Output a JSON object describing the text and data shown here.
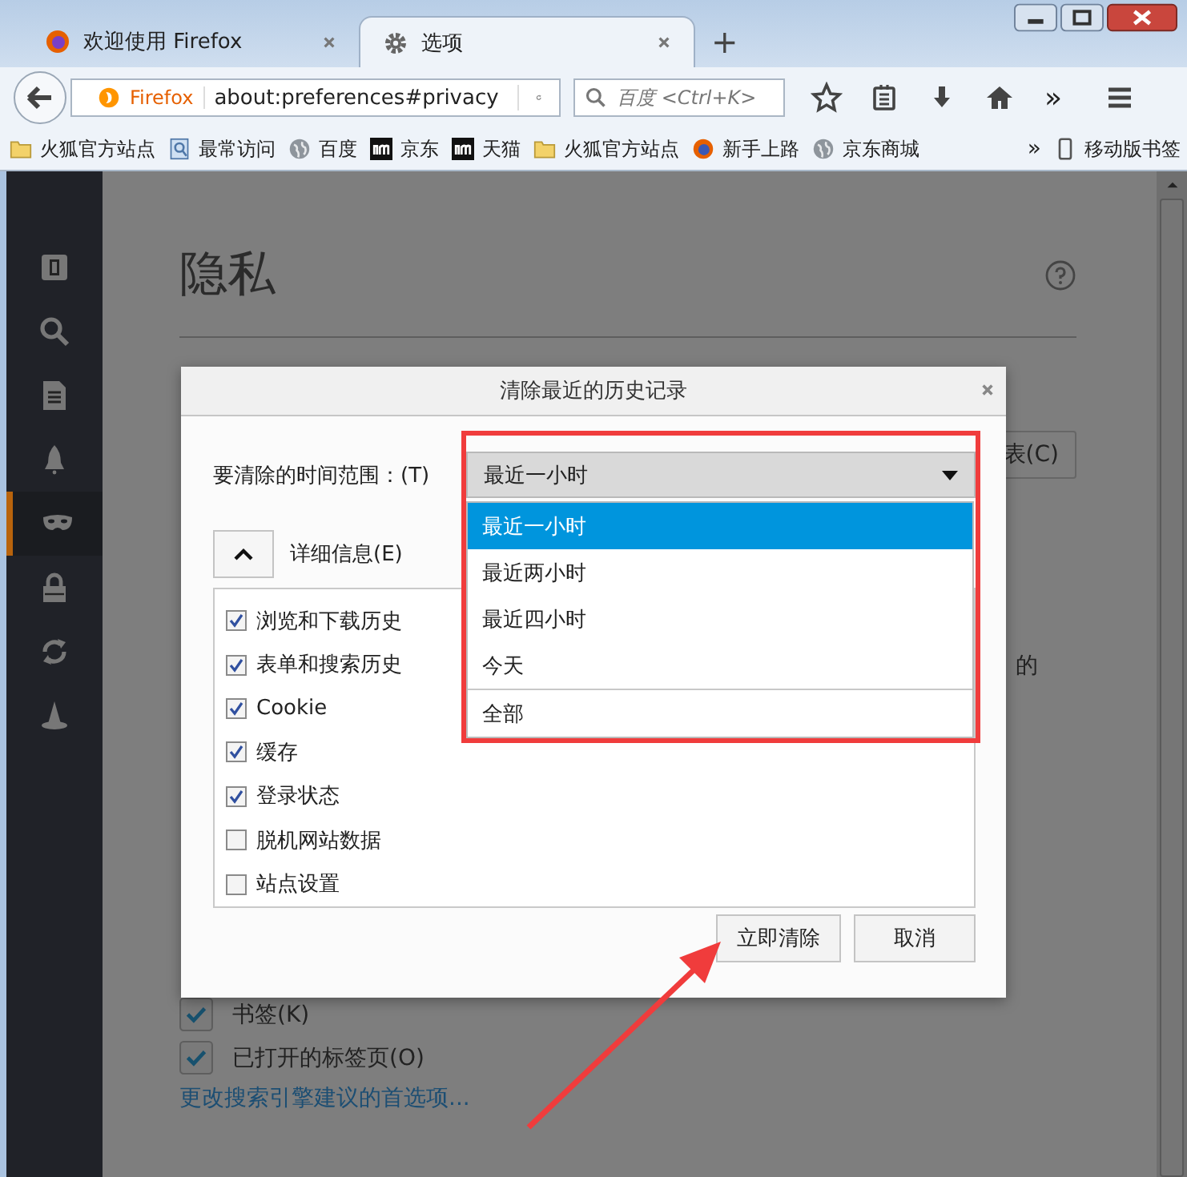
{
  "tabs": [
    {
      "title": "欢迎使用 Firefox",
      "kind": "firefox",
      "selected": false
    },
    {
      "title": "选项",
      "kind": "gear",
      "selected": true
    }
  ],
  "new_tab": "+",
  "address_bar": {
    "identity": "Firefox",
    "url": "about:preferences#privacy"
  },
  "search": {
    "placeholder": "百度 <Ctrl+K>"
  },
  "toolbar_overflow": "»",
  "bookmarks": [
    {
      "label": "火狐官方站点",
      "kind": "folder"
    },
    {
      "label": "最常访问",
      "kind": "smart"
    },
    {
      "label": "百度",
      "kind": "globe"
    },
    {
      "label": "京东",
      "kind": "m"
    },
    {
      "label": "天猫",
      "kind": "m"
    },
    {
      "label": "火狐官方站点",
      "kind": "folder"
    },
    {
      "label": "新手上路",
      "kind": "firefox"
    },
    {
      "label": "京东商城",
      "kind": "globe"
    }
  ],
  "bookmarks_overflow": "»",
  "mobile_bookmarks": "移动版书签",
  "sidebar": {
    "items": [
      {
        "kind": "general",
        "selected": false
      },
      {
        "kind": "search",
        "selected": false
      },
      {
        "kind": "content",
        "selected": false
      },
      {
        "kind": "applications",
        "selected": false
      },
      {
        "kind": "privacy",
        "selected": true
      },
      {
        "kind": "security",
        "selected": false
      },
      {
        "kind": "sync",
        "selected": false
      },
      {
        "kind": "advanced",
        "selected": false
      }
    ]
  },
  "page": {
    "title": "隐私",
    "partial_button": "表(C)",
    "partial_text": "的",
    "options": [
      {
        "label": "书签(K)",
        "checked": true
      },
      {
        "label": "已打开的标签页(O)",
        "checked": true
      }
    ],
    "link": "更改搜索引擎建议的首选项..."
  },
  "dialog": {
    "title": "清除最近的历史记录",
    "range_label": "要清除的时间范围：(T)",
    "range_value": "最近一小时",
    "dropdown": [
      {
        "label": "最近一小时",
        "selected": true
      },
      {
        "label": "最近两小时",
        "selected": false
      },
      {
        "label": "最近四小时",
        "selected": false
      },
      {
        "label": "今天",
        "selected": false
      },
      {
        "label": "全部",
        "selected": false
      }
    ],
    "details_toggle": "详细信息(E)",
    "items": [
      {
        "label": "浏览和下载历史",
        "checked": true
      },
      {
        "label": "表单和搜索历史",
        "checked": true
      },
      {
        "label": "Cookie",
        "checked": true
      },
      {
        "label": "缓存",
        "checked": true
      },
      {
        "label": "登录状态",
        "checked": true
      },
      {
        "label": "脱机网站数据",
        "checked": false
      },
      {
        "label": "站点设置",
        "checked": false
      }
    ],
    "buttons": [
      "立即清除",
      "取消"
    ]
  }
}
